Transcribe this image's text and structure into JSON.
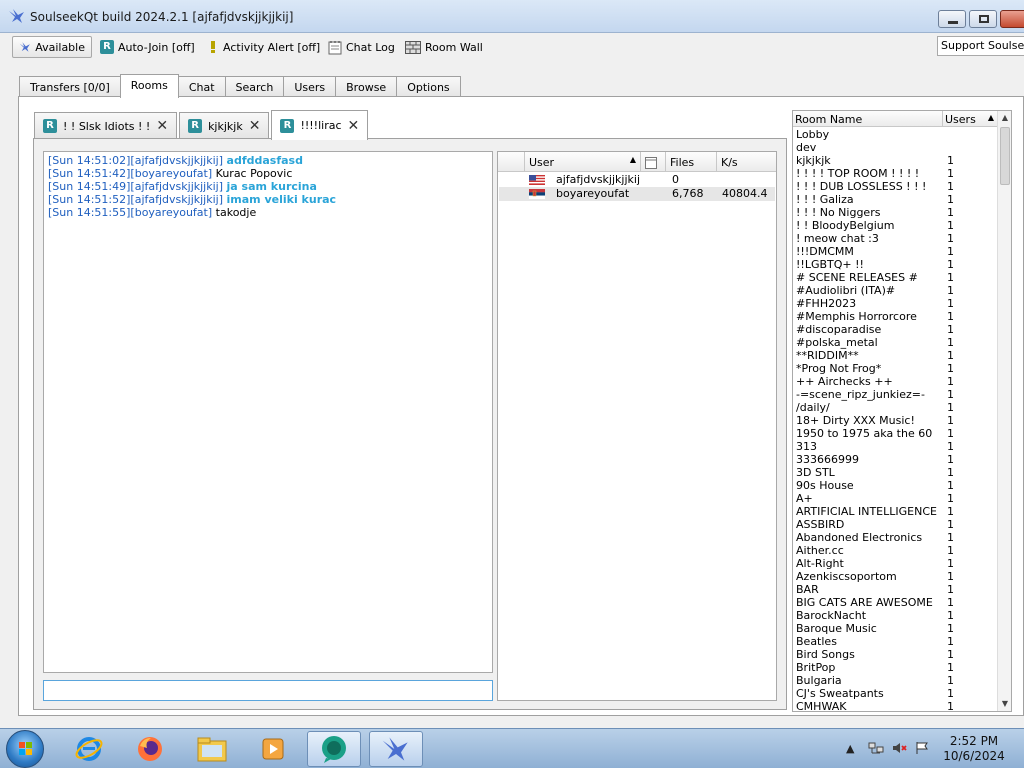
{
  "window": {
    "title": "SoulseekQt build 2024.2.1 [ajfafjdvskjjkjjkij]"
  },
  "toolbar": {
    "available_label": "Available",
    "autojoin_label": "Auto-Join [off]",
    "activity_label": "Activity Alert [off]",
    "chatlog_label": "Chat Log",
    "roomwall_label": "Room Wall",
    "support_value": "Support Soulseek"
  },
  "main_tabs": [
    "Transfers [0/0]",
    "Rooms",
    "Chat",
    "Search",
    "Users",
    "Browse",
    "Options"
  ],
  "room_tabs": [
    {
      "label": "! ! Slsk Idiots ! !"
    },
    {
      "label": "kjkjkjk"
    },
    {
      "label": "!!!!lirac"
    }
  ],
  "chat": {
    "messages": [
      {
        "time": "[Sun 14:51:02]",
        "user": "[ajfafjdvskjjkjjkij]",
        "text": "adfddasfasd",
        "self": true
      },
      {
        "time": "[Sun 14:51:42]",
        "user": "[boyareyoufat]",
        "text": "Kurac Popovic",
        "self": false
      },
      {
        "time": "[Sun 14:51:49]",
        "user": "[ajfafjdvskjjkjjkij]",
        "text": "ja sam kurcina",
        "self": true
      },
      {
        "time": "[Sun 14:51:52]",
        "user": "[ajfafjdvskjjkjjkij]",
        "text": "imam veliki kurac",
        "self": true
      },
      {
        "time": "[Sun 14:51:55]",
        "user": "[boyareyoufat]",
        "text": "takodje",
        "self": false
      }
    ],
    "input_value": ""
  },
  "users_table": {
    "headers": {
      "user": "User",
      "files": "Files",
      "speed": "K/s"
    },
    "rows": [
      {
        "user": "ajfafjdvskjjkjjkij",
        "files": "0",
        "speed": "",
        "flag": "us-flag"
      },
      {
        "user": "boyareyoufat",
        "files": "6,768",
        "speed": "40804.4",
        "flag": "rs-flag"
      }
    ]
  },
  "rooms_table": {
    "headers": {
      "name": "Room Name",
      "users": "Users"
    },
    "rows": [
      {
        "name": "Lobby",
        "users": ""
      },
      {
        "name": "dev",
        "users": ""
      },
      {
        "name": "kjkjkjk",
        "users": "1"
      },
      {
        "name": "! ! ! ! TOP ROOM ! ! ! !",
        "users": "1"
      },
      {
        "name": "! ! ! DUB LOSSLESS ! ! !",
        "users": "1"
      },
      {
        "name": "! ! ! Galiza",
        "users": "1"
      },
      {
        "name": "! ! ! No Niggers",
        "users": "1"
      },
      {
        "name": "! ! BloodyBelgium",
        "users": "1"
      },
      {
        "name": "! meow chat :3",
        "users": "1"
      },
      {
        "name": "!!!DMCMM",
        "users": "1"
      },
      {
        "name": "!!LGBTQ+ !!",
        "users": "1"
      },
      {
        "name": "# SCENE RELEASES #",
        "users": "1"
      },
      {
        "name": "#Audiolibri (ITA)#",
        "users": "1"
      },
      {
        "name": "#FHH2023",
        "users": "1"
      },
      {
        "name": "#Memphis Horrorcore",
        "users": "1"
      },
      {
        "name": "#discoparadise",
        "users": "1"
      },
      {
        "name": "#polska_metal",
        "users": "1"
      },
      {
        "name": "**RIDDIM**",
        "users": "1"
      },
      {
        "name": "*Prog Not Frog*",
        "users": "1"
      },
      {
        "name": "++ Airchecks ++",
        "users": "1"
      },
      {
        "name": "-=scene_ripz_junkiez=-",
        "users": "1"
      },
      {
        "name": "/daily/",
        "users": "1"
      },
      {
        "name": "18+ Dirty XXX Music!",
        "users": "1"
      },
      {
        "name": "1950 to 1975 aka the 60",
        "users": "1"
      },
      {
        "name": "313",
        "users": "1"
      },
      {
        "name": "333666999",
        "users": "1"
      },
      {
        "name": "3D STL",
        "users": "1"
      },
      {
        "name": "90s House",
        "users": "1"
      },
      {
        "name": "A+",
        "users": "1"
      },
      {
        "name": "ARTIFICIAL INTELLIGENCE",
        "users": "1"
      },
      {
        "name": "ASSBIRD",
        "users": "1"
      },
      {
        "name": "Abandoned Electronics",
        "users": "1"
      },
      {
        "name": "Aither.cc",
        "users": "1"
      },
      {
        "name": "Alt-Right",
        "users": "1"
      },
      {
        "name": "Azenkiscsoportom",
        "users": "1"
      },
      {
        "name": "BAR",
        "users": "1"
      },
      {
        "name": "BIG CATS ARE AWESOME",
        "users": "1"
      },
      {
        "name": "BarockNacht",
        "users": "1"
      },
      {
        "name": "Baroque Music",
        "users": "1"
      },
      {
        "name": "Beatles",
        "users": "1"
      },
      {
        "name": "Bird Songs",
        "users": "1"
      },
      {
        "name": "BritPop",
        "users": "1"
      },
      {
        "name": "Bulgaria",
        "users": "1"
      },
      {
        "name": "CJ's Sweatpants",
        "users": "1"
      },
      {
        "name": "CMHWAK",
        "users": "1"
      }
    ]
  },
  "taskbar": {
    "time": "2:52 PM",
    "date": "10/6/2024"
  }
}
